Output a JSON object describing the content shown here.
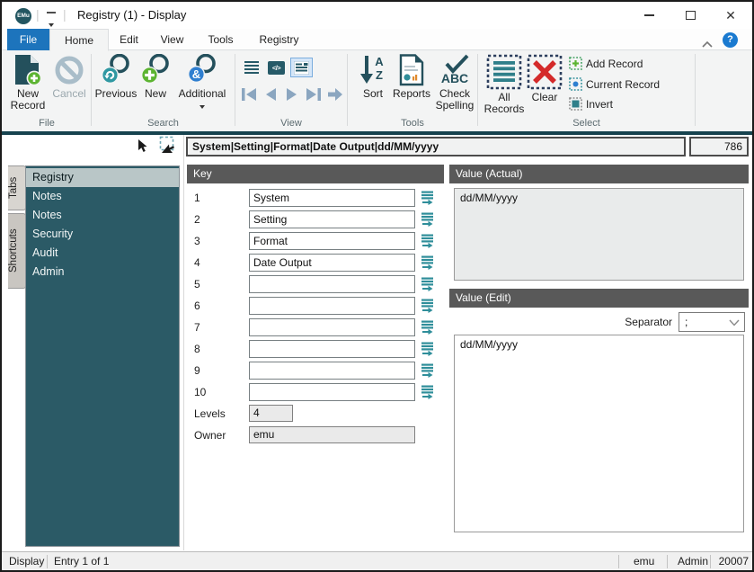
{
  "colors": {
    "accent_teal": "#24505c",
    "sidebar_teal": "#2b5a66",
    "header_gray": "#595959",
    "file_tab_blue": "#1d74bc",
    "green": "#5cb431",
    "red": "#d42a2a",
    "blue": "#2f7fd0"
  },
  "titlebar": {
    "app_icon": "EMu",
    "title": "Registry (1) - Display"
  },
  "ribbon_tabs": [
    {
      "label": "File"
    },
    {
      "label": "Home"
    },
    {
      "label": "Edit"
    },
    {
      "label": "View"
    },
    {
      "label": "Tools"
    },
    {
      "label": "Registry"
    }
  ],
  "ribbon": {
    "file_group": {
      "label": "File",
      "new_record": "New Record",
      "cancel": "Cancel"
    },
    "search_group": {
      "label": "Search",
      "previous": "Previous",
      "new": "New",
      "additional": "Additional"
    },
    "view_group": {
      "label": "View",
      "code_view": "</>"
    },
    "tools_group": {
      "label": "Tools",
      "sort": "Sort",
      "reports": "Reports",
      "check_spelling": "Check Spelling",
      "abc": "ABC"
    },
    "select_group": {
      "label": "Select",
      "all_records": "All Records",
      "clear": "Clear",
      "add_record": "Add Record",
      "current_record": "Current Record",
      "invert": "Invert"
    }
  },
  "summary_bar": {
    "text": "System|Setting|Format|Date Output|dd/MM/yyyy",
    "count": "786"
  },
  "sidebar": {
    "tabs": [
      {
        "label": "Tabs"
      },
      {
        "label": "Shortcuts"
      }
    ],
    "items": [
      {
        "label": "Registry",
        "selected": true
      },
      {
        "label": "Notes",
        "selected": false
      },
      {
        "label": "Notes",
        "selected": false
      },
      {
        "label": "Security",
        "selected": false
      },
      {
        "label": "Audit",
        "selected": false
      },
      {
        "label": "Admin",
        "selected": false
      }
    ]
  },
  "key_panel": {
    "header": "Key",
    "rows": [
      {
        "num": "1",
        "value": "System"
      },
      {
        "num": "2",
        "value": "Setting"
      },
      {
        "num": "3",
        "value": "Format"
      },
      {
        "num": "4",
        "value": "Date Output"
      },
      {
        "num": "5",
        "value": ""
      },
      {
        "num": "6",
        "value": ""
      },
      {
        "num": "7",
        "value": ""
      },
      {
        "num": "8",
        "value": ""
      },
      {
        "num": "9",
        "value": ""
      },
      {
        "num": "10",
        "value": ""
      }
    ],
    "levels_label": "Levels",
    "levels_value": "4",
    "owner_label": "Owner",
    "owner_value": "emu"
  },
  "value_panel": {
    "actual_header": "Value (Actual)",
    "actual_value": "dd/MM/yyyy",
    "edit_header": "Value (Edit)",
    "separator_label": "Separator",
    "separator_value": ";",
    "edit_value": "dd/MM/yyyy"
  },
  "statusbar": {
    "mode": "Display",
    "entry": "Entry 1 of 1",
    "user": "emu",
    "group": "Admin",
    "number": "20007"
  }
}
